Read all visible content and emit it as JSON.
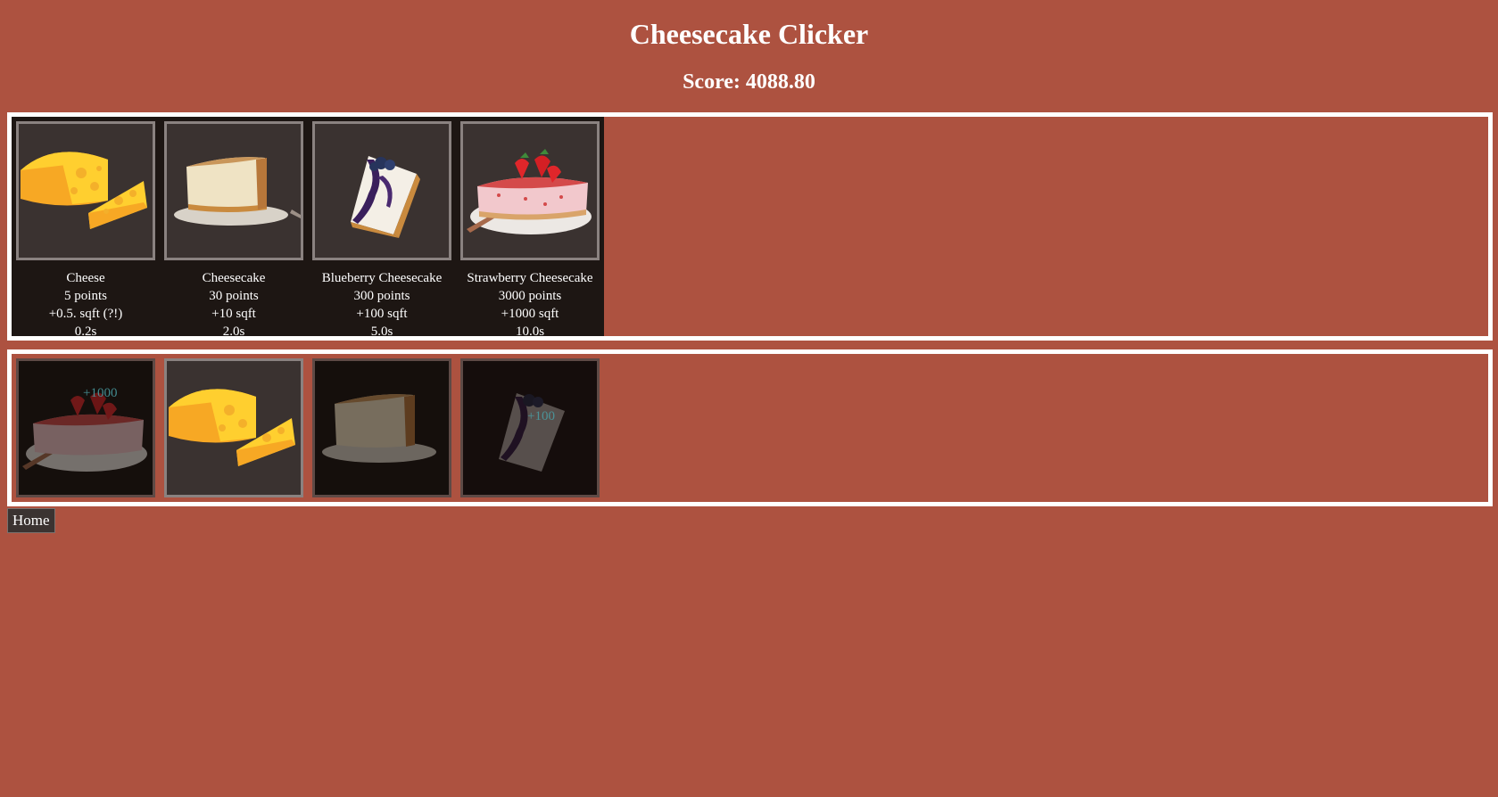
{
  "app": {
    "title": "Cheesecake Clicker",
    "score_text": "Score: 4088.80"
  },
  "shop": {
    "items": [
      {
        "name": "Cheese",
        "cost": "5 points",
        "gain": "+0.5. sqft (?!)",
        "time": "0.2s",
        "icon": "cheese-icon"
      },
      {
        "name": "Cheesecake",
        "cost": "30 points",
        "gain": "+10 sqft",
        "time": "2.0s",
        "icon": "cheesecake-icon"
      },
      {
        "name": "Blueberry Cheesecake",
        "cost": "300 points",
        "gain": "+100 sqft",
        "time": "5.0s",
        "icon": "blueberry-cheesecake-icon"
      },
      {
        "name": "Strawberry Cheesecake",
        "cost": "3000 points",
        "gain": "+1000 sqft",
        "time": "10.0s",
        "icon": "strawberry-cheesecake-icon"
      }
    ]
  },
  "field": {
    "tiles": [
      {
        "icon": "strawberry-cheesecake-icon",
        "active": false,
        "floating_text": "+1000"
      },
      {
        "icon": "cheese-icon",
        "active": true,
        "floating_text": ""
      },
      {
        "icon": "cheesecake-icon",
        "active": false,
        "floating_text": ""
      },
      {
        "icon": "blueberry-cheesecake-icon",
        "active": false,
        "floating_text": "+100"
      }
    ]
  },
  "nav": {
    "home_label": "Home"
  },
  "colors": {
    "background": "#ad5240",
    "panel_border": "#ffffff",
    "shop_background": "#1d1613",
    "card_background": "#3a3230",
    "floating_text": "#4aa0a6"
  }
}
